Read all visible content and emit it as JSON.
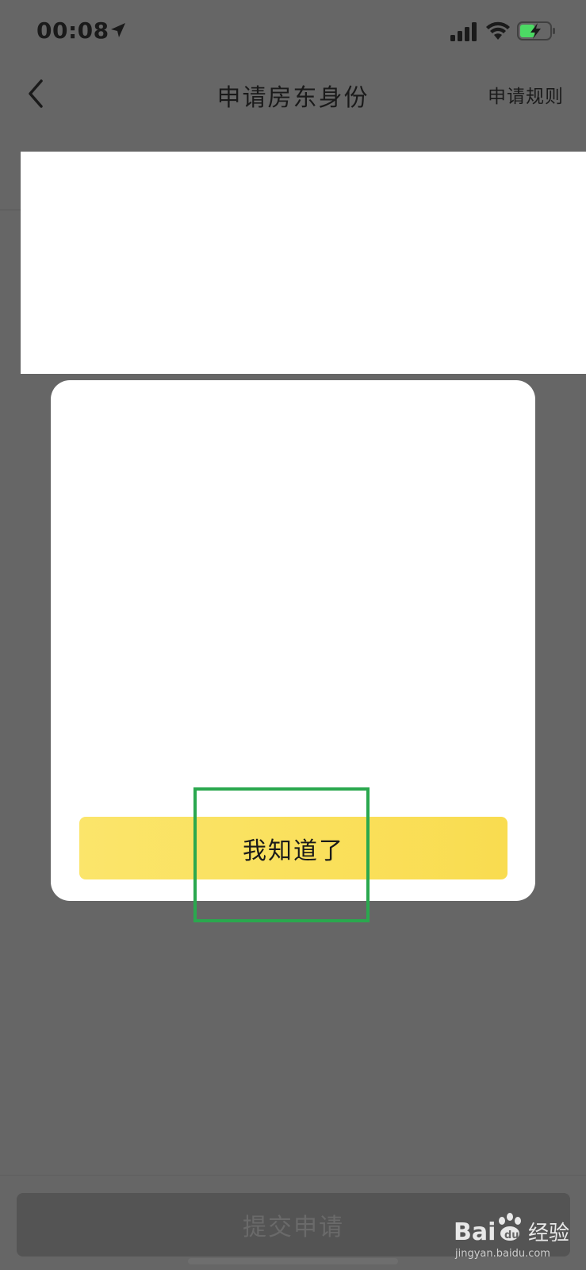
{
  "status_bar": {
    "time": "00:08",
    "icons": [
      "location-arrow-icon",
      "signal-bars-icon",
      "wifi-icon",
      "battery-charging-icon"
    ],
    "battery_accent": "#4cd964"
  },
  "nav": {
    "back_icon": "chevron-left-icon",
    "title": "申请房东身份",
    "rules_link": "申请规则"
  },
  "modal": {
    "ack_button": "我知道了",
    "button_color": "#f9dc50",
    "highlight_color": "#2aa84e"
  },
  "footer": {
    "submit_button": "提交申请"
  },
  "watermark": {
    "brand": "Baidu经验",
    "url": "jingyan.baidu.com"
  }
}
